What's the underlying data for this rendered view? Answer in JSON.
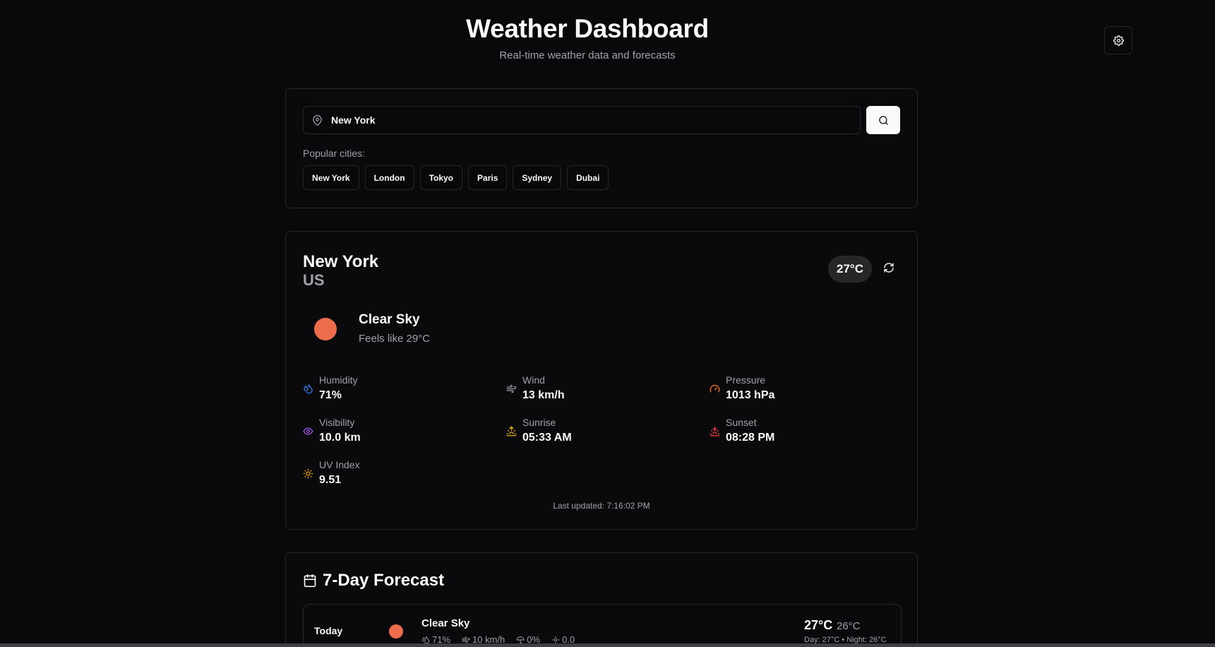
{
  "header": {
    "title": "Weather Dashboard",
    "subtitle": "Real-time weather data and forecasts",
    "settings_icon": "gear-icon"
  },
  "search": {
    "value": "New York",
    "location_icon": "map-pin-icon",
    "search_icon": "search-icon",
    "popular_label": "Popular cities:",
    "popular_cities": [
      "New York",
      "London",
      "Tokyo",
      "Paris",
      "Sydney",
      "Dubai"
    ]
  },
  "current": {
    "city": "New York",
    "country": "US",
    "temp_badge": "27°C",
    "condition": "Clear Sky",
    "feels_like": "Feels like 29°C",
    "stats": {
      "humidity": {
        "label": "Humidity",
        "value": "71%",
        "color": "#3b82f6"
      },
      "wind": {
        "label": "Wind",
        "value": "13 km/h",
        "color": "#9ca3af"
      },
      "pressure": {
        "label": "Pressure",
        "value": "1013 hPa",
        "color": "#f97316"
      },
      "visibility": {
        "label": "Visibility",
        "value": "10.0 km",
        "color": "#a855f7"
      },
      "sunrise": {
        "label": "Sunrise",
        "value": "05:33 AM",
        "color": "#eab308"
      },
      "sunset": {
        "label": "Sunset",
        "value": "08:28 PM",
        "color": "#ef4444"
      },
      "uv": {
        "label": "UV Index",
        "value": "9.51",
        "color": "#f59e0b"
      }
    },
    "last_updated": "Last updated: 7:16:02 PM",
    "sun_color": "#ec6c4b"
  },
  "forecast": {
    "title": "7-Day Forecast",
    "days": [
      {
        "day": "Today",
        "condition": "Clear Sky",
        "humidity": "71%",
        "wind": "10 km/h",
        "precip": "0%",
        "uv": "0.0",
        "high": "27°C",
        "low": "26°C",
        "day_night": "Day: 27°C • Night: 26°C"
      }
    ]
  }
}
